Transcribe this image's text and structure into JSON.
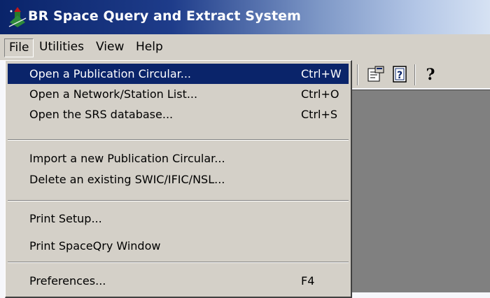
{
  "window": {
    "title": "BR Space Query and Extract System"
  },
  "menubar": {
    "items": [
      "File",
      "Utilities",
      "View",
      "Help"
    ],
    "active": "File"
  },
  "file_menu": {
    "groups": [
      [
        {
          "label": "Open a Publication Circular...",
          "shortcut": "Ctrl+W",
          "highlighted": true
        },
        {
          "label": "Open a Network/Station List...",
          "shortcut": "Ctrl+O"
        },
        {
          "label": "Open the SRS database...",
          "shortcut": "Ctrl+S"
        }
      ],
      [
        {
          "label": "Import a new Publication Circular..."
        },
        {
          "label": "Delete an existing SWIC/IFIC/NSL..."
        }
      ],
      [
        {
          "label": "Print Setup..."
        },
        {
          "label": "Print SpaceQry Window"
        }
      ],
      [
        {
          "label": "Preferences...",
          "shortcut": "F4"
        }
      ]
    ]
  },
  "toolbar": {
    "icons": [
      "properties-icon",
      "help-topics-icon",
      "whats-this-help-icon"
    ]
  },
  "colors": {
    "menu_highlight": "#0a246a",
    "workspace": "#808080",
    "face": "#d4d0c8"
  }
}
